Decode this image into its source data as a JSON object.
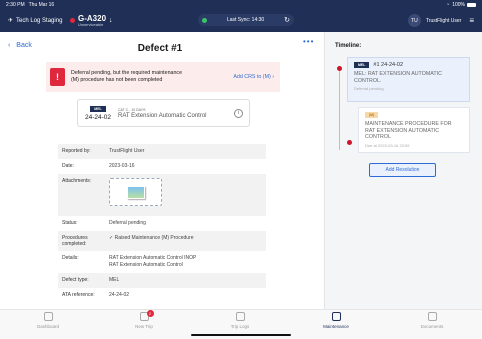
{
  "status_bar": {
    "time": "2:30 PM",
    "date": "Thu Mar 16",
    "battery": "100%"
  },
  "header": {
    "app_name": "Tech Log Staging",
    "aircraft_reg": "G-A320",
    "aircraft_status": "Unserviceable",
    "sync_text": "Last Sync: 14:30",
    "user_initials": "TU",
    "user_name": "TrustFlight User"
  },
  "page": {
    "back_label": "Back",
    "title": "Defect #1",
    "more_label": "•••"
  },
  "warning": {
    "text": "Deferral pending, but the required maintenance (M) procedure has not been completed",
    "action": "Add CRS to (M)"
  },
  "defect_card": {
    "tag": "MEL",
    "ata": "24-24-02",
    "category": "CAT C - 10 DAYS",
    "description": "RAT Extension Automatic Control"
  },
  "details": [
    {
      "label": "Reported by:",
      "value": "TrustFlight User"
    },
    {
      "label": "Date:",
      "value": "2023-03-16"
    },
    {
      "label": "Attachments:",
      "value": ""
    },
    {
      "label": "Status:",
      "value": "Deferral pending"
    },
    {
      "label": "Procedures completed:",
      "value": "✓ Raised Maintenance (M) Procedure"
    },
    {
      "label": "Details:",
      "value": "RAT Extension Automatic Control INOP\nRAT Extension Automatic Control"
    },
    {
      "label": "Defect type:",
      "value": "MEL"
    },
    {
      "label": "ATA reference:",
      "value": "24-24-02"
    }
  ],
  "timeline": {
    "title": "Timeline:",
    "item1": {
      "tag": "MEL",
      "title": "#1 24-24-02",
      "body": "MEL: RAT EXTENSION AUTOMATIC CONTROL.",
      "sub": "Deferral pending"
    },
    "item2": {
      "tag": "(M)",
      "body": "MAINTENANCE PROCEDURE FOR RAT EXTENSION AUTOMATIC CONTROL",
      "sub": "Due at 2023-03-16 23:59"
    },
    "add_resolution": "Add Resolution"
  },
  "tabs": [
    {
      "label": "Dashboard",
      "icon": "dashboard-icon"
    },
    {
      "label": "New Trip",
      "icon": "new-trip-icon",
      "badge": "2"
    },
    {
      "label": "Trip Logs",
      "icon": "trip-logs-icon"
    },
    {
      "label": "Maintenance",
      "icon": "maintenance-icon"
    },
    {
      "label": "Documents",
      "icon": "documents-icon"
    }
  ],
  "colors": {
    "navy": "#1f2f56",
    "accent": "#2e6bd6",
    "alert": "#e0283d"
  }
}
